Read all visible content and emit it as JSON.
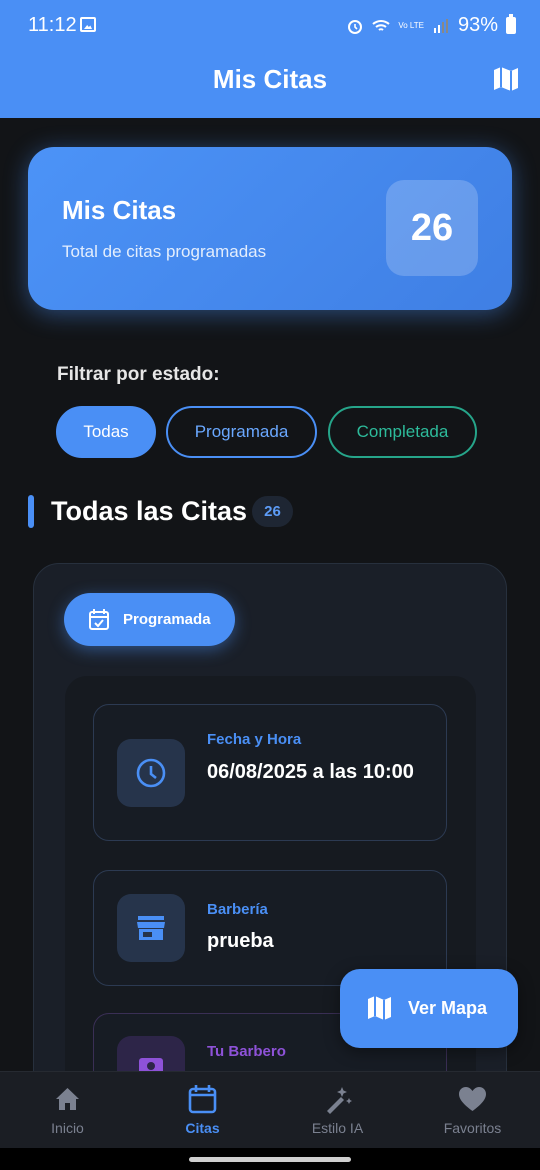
{
  "status_bar": {
    "time": "11:12",
    "battery": "93%",
    "network": "Vo LTE"
  },
  "app_bar": {
    "title": "Mis Citas",
    "map_icon": "map-icon"
  },
  "summary": {
    "title": "Mis Citas",
    "subtitle": "Total de citas programadas",
    "count": "26"
  },
  "filter": {
    "label": "Filtrar por estado:",
    "chips": [
      {
        "label": "Todas",
        "selected": true
      },
      {
        "label": "Programada",
        "selected": false
      },
      {
        "label": "Completada",
        "selected": false
      }
    ]
  },
  "section": {
    "title": "Todas las Citas",
    "count": "26"
  },
  "appointment": {
    "status": "Programada",
    "status_icon": "calendar-check-icon",
    "date": {
      "label": "Fecha y Hora",
      "value": "06/08/2025 a las 10:00",
      "icon": "clock-icon"
    },
    "shop": {
      "label": "Barbería",
      "value": "prueba",
      "icon": "store-icon"
    },
    "barber": {
      "label": "Tu Barbero",
      "icon": "barber-icon"
    }
  },
  "fab": {
    "label": "Ver Mapa",
    "icon": "map-icon"
  },
  "bottom_nav": [
    {
      "label": "Inicio",
      "icon": "home-icon",
      "active": false
    },
    {
      "label": "Citas",
      "icon": "calendar-icon",
      "active": true
    },
    {
      "label": "Estilo IA",
      "icon": "magic-wand-icon",
      "active": false
    },
    {
      "label": "Favoritos",
      "icon": "heart-icon",
      "active": false
    }
  ],
  "colors": {
    "primary": "#4a8ff5",
    "background": "#121417",
    "completed": "#26a58a",
    "barber_accent": "#8e52d8"
  }
}
